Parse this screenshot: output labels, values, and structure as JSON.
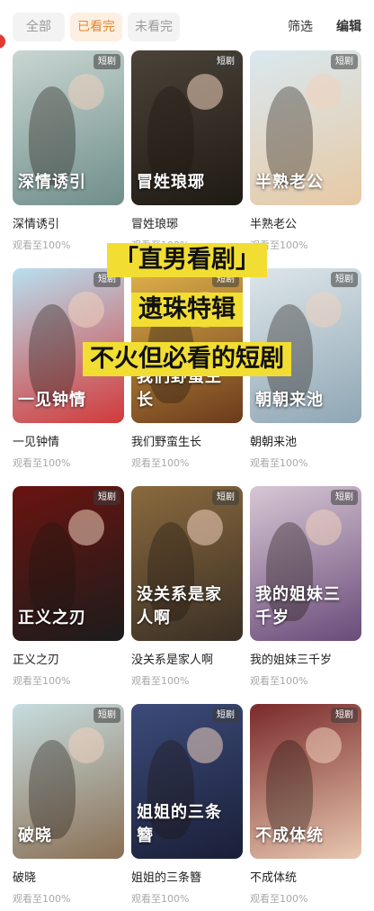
{
  "tabs": [
    {
      "label": "全部",
      "active": false
    },
    {
      "label": "已看完",
      "active": true
    },
    {
      "label": "未看完",
      "active": false
    }
  ],
  "actions": {
    "filter": "筛选",
    "edit": "编辑"
  },
  "badge_label": "短剧",
  "dramas": [
    {
      "title": "深情诱引",
      "progress": "观看至100%",
      "poster_text": "深情诱引",
      "colors": [
        "#c9d6d2",
        "#6f8e8a"
      ]
    },
    {
      "title": "冒姓琅琊",
      "progress": "观看至100%",
      "poster_text": "冒姓琅琊",
      "colors": [
        "#4b4338",
        "#1f1a14"
      ]
    },
    {
      "title": "半熟老公",
      "progress": "观看至100%",
      "poster_text": "半熟老公",
      "colors": [
        "#d9e8f0",
        "#e7c9a4"
      ]
    },
    {
      "title": "一见钟情",
      "progress": "观看至100%",
      "poster_text": "一见钟情",
      "colors": [
        "#b8dff0",
        "#d23a3a"
      ]
    },
    {
      "title": "我们野蛮生长",
      "progress": "观看至100%",
      "poster_text": "我们野蛮生长",
      "colors": [
        "#e0b24a",
        "#6b3a1c"
      ]
    },
    {
      "title": "朝朝来池",
      "progress": "观看至100%",
      "poster_text": "朝朝来池",
      "colors": [
        "#dde6ea",
        "#8fa6b4"
      ]
    },
    {
      "title": "正义之刃",
      "progress": "观看至100%",
      "poster_text": "正义之刃",
      "colors": [
        "#6a1410",
        "#1c1c1c"
      ]
    },
    {
      "title": "没关系是家人啊",
      "progress": "观看至100%",
      "poster_text": "没关系是家人啊",
      "colors": [
        "#8a6a3e",
        "#3a2f25"
      ]
    },
    {
      "title": "我的姐妹三千岁",
      "progress": "观看至100%",
      "poster_text": "我的姐妹三千岁",
      "colors": [
        "#d7c7d4",
        "#6a4b7a"
      ]
    },
    {
      "title": "破晓",
      "progress": "观看至100%",
      "poster_text": "破晓",
      "colors": [
        "#c7dde0",
        "#8a6f54"
      ]
    },
    {
      "title": "姐姐的三条簪",
      "progress": "观看至100%",
      "poster_text": "姐姐的三条簪",
      "colors": [
        "#3c4b7a",
        "#1a1f38"
      ]
    },
    {
      "title": "不成体统",
      "progress": "观看至100%",
      "poster_text": "不成体统",
      "colors": [
        "#7a2a2a",
        "#e8c7b0"
      ]
    }
  ],
  "overlay": {
    "line1": "「直男看剧」",
    "line2": "遗珠特辑",
    "line3": "不火但必看的短剧"
  },
  "theme": {
    "accent": "#e7852c",
    "highlight": "#f2de33"
  }
}
